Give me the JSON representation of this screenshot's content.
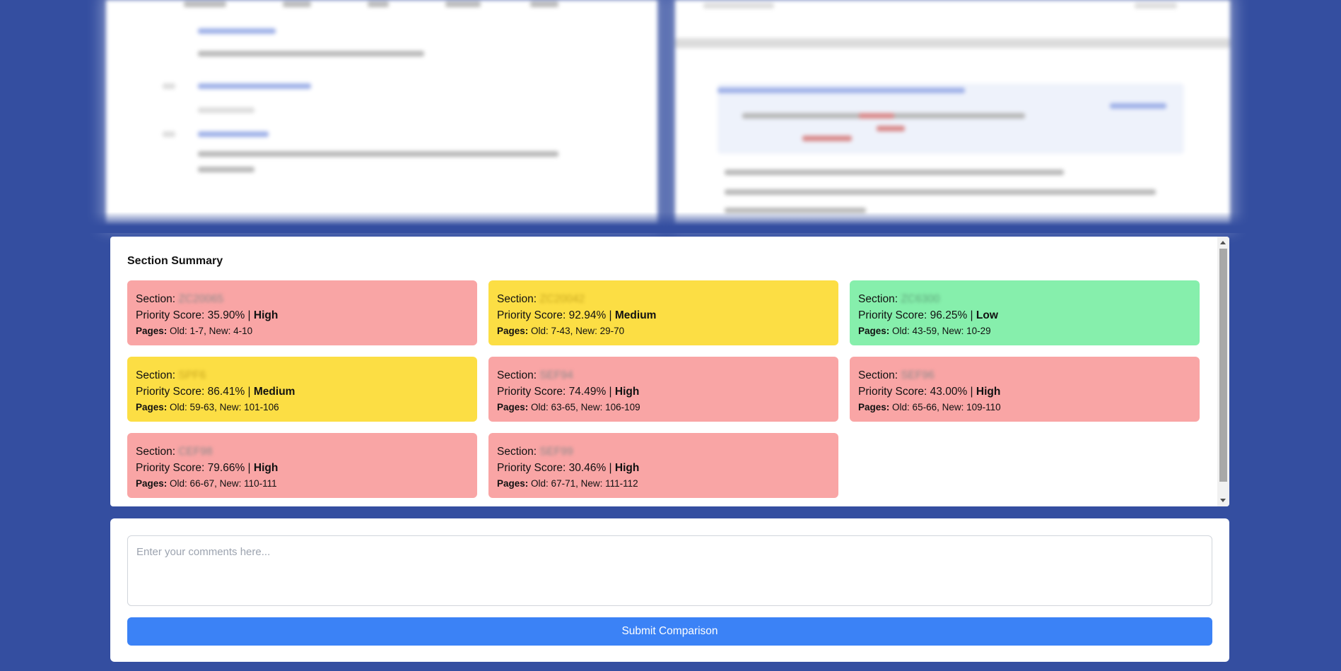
{
  "summary": {
    "title": "Section Summary",
    "section_label": "Section:",
    "priority_label": "Priority Score:",
    "separator": "|",
    "pages_label": "Pages:",
    "cards": [
      {
        "code": "ZC20065",
        "score": "35.90%",
        "priority": "High",
        "pages": "Old: 1-7, New: 4-10",
        "level": "high"
      },
      {
        "code": "ZC20042",
        "score": "92.94%",
        "priority": "Medium",
        "pages": "Old: 7-43, New: 29-70",
        "level": "medium"
      },
      {
        "code": "ZC6300",
        "score": "96.25%",
        "priority": "Low",
        "pages": "Old: 43-59, New: 10-29",
        "level": "low"
      },
      {
        "code": "SPF6",
        "score": "86.41%",
        "priority": "Medium",
        "pages": "Old: 59-63, New: 101-106",
        "level": "medium"
      },
      {
        "code": "SEF94",
        "score": "74.49%",
        "priority": "High",
        "pages": "Old: 63-65, New: 106-109",
        "level": "high"
      },
      {
        "code": "SEF96",
        "score": "43.00%",
        "priority": "High",
        "pages": "Old: 65-66, New: 109-110",
        "level": "high"
      },
      {
        "code": "CEF98",
        "score": "79.66%",
        "priority": "High",
        "pages": "Old: 66-67, New: 110-111",
        "level": "high"
      },
      {
        "code": "SEF99",
        "score": "30.46%",
        "priority": "High",
        "pages": "Old: 67-71, New: 111-112",
        "level": "high"
      }
    ]
  },
  "comments": {
    "placeholder": "Enter your comments here...",
    "value": ""
  },
  "submit": {
    "label": "Submit Comparison"
  },
  "colors": {
    "background": "#344ea0",
    "high": "#f9a5a5",
    "medium": "#fcde44",
    "low": "#86efac",
    "button": "#3b82f6"
  }
}
